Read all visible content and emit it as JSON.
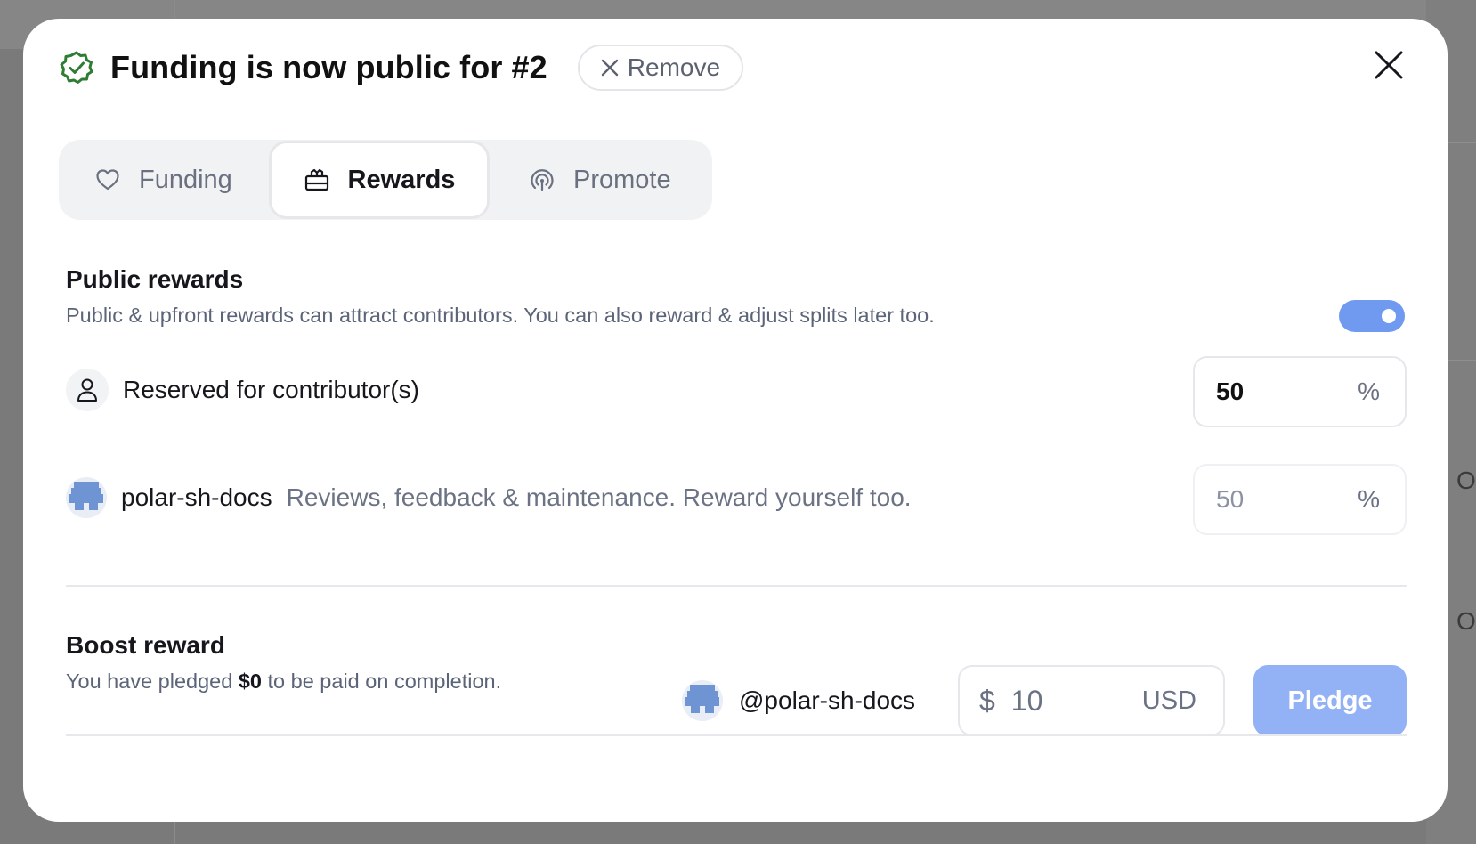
{
  "header": {
    "title": "Funding is now public for #2",
    "remove_label": "Remove"
  },
  "tabs": [
    {
      "label": "Funding",
      "icon": "heart-icon",
      "active": false
    },
    {
      "label": "Rewards",
      "icon": "gift-icon",
      "active": true
    },
    {
      "label": "Promote",
      "icon": "broadcast-icon",
      "active": false
    }
  ],
  "public_rewards": {
    "title": "Public rewards",
    "description": "Public & upfront rewards can attract contributors. You can also reward & adjust splits later too.",
    "toggle_on": true,
    "rows": [
      {
        "label": "Reserved for contributor(s)",
        "value": "50",
        "unit": "%"
      },
      {
        "label": "polar-sh-docs",
        "sub": "Reviews, feedback & maintenance. Reward yourself too.",
        "value": "50",
        "unit": "%"
      }
    ]
  },
  "boost": {
    "title": "Boost reward",
    "desc_prefix": "You have pledged",
    "desc_amount": "$0",
    "desc_suffix": "to be paid on completion.",
    "user": "@polar-sh-docs",
    "currency_symbol": "$",
    "amount": "10",
    "currency_code": "USD",
    "pledge_label": "Pledge"
  },
  "background": {
    "side_text_1": "O",
    "side_text_2": "O"
  },
  "colors": {
    "accent": "#6f9af0",
    "pledge_bg": "#93b2f5",
    "success": "#2e7d32",
    "overlay": "#7a7a7a"
  }
}
